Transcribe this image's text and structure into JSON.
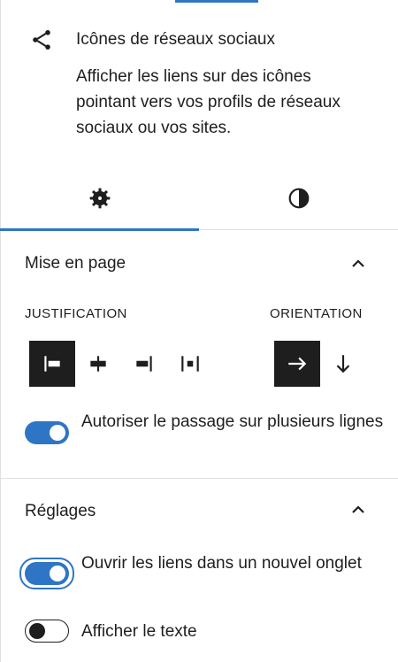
{
  "block": {
    "icon": "share-icon",
    "title": "Icônes de réseaux sociaux",
    "description": "Afficher les liens sur des icônes pointant vers vos profils de réseaux sociaux ou vos sites."
  },
  "tabs": [
    {
      "name": "settings",
      "icon": "gear-icon",
      "active": true
    },
    {
      "name": "styles",
      "icon": "half-circle-contrast-icon",
      "active": false
    }
  ],
  "layout": {
    "title": "Mise en page",
    "expanded": true,
    "justification_label": "JUSTIFICATION",
    "orientation_label": "ORIENTATION",
    "justification_options": [
      "justify-left-icon",
      "justify-center-icon",
      "justify-right-icon",
      "justify-space-between-icon"
    ],
    "justification_selected": "justify-left-icon",
    "orientation_options": [
      "arrow-right-icon",
      "arrow-down-icon"
    ],
    "orientation_selected": "arrow-right-icon",
    "wrap_label": "Autoriser le passage sur plusieurs lignes",
    "wrap_on": true
  },
  "settings": {
    "title": "Réglages",
    "expanded": true,
    "new_tab_label": "Ouvrir les liens dans un nouvel onglet",
    "new_tab_on": true,
    "show_text_label": "Afficher le texte",
    "show_text_on": false
  },
  "colors": {
    "accent": "#2f75c5",
    "text": "#1e1e1e",
    "border": "#e0e0e0"
  }
}
